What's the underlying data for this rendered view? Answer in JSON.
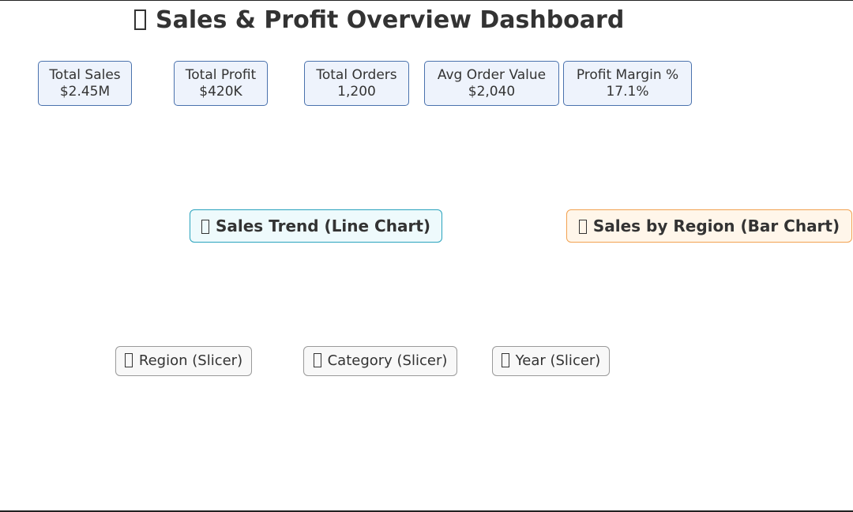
{
  "dashboard": {
    "title": "Sales & Profit Overview Dashboard",
    "title_icon": "missing-glyph-icon"
  },
  "kpis": [
    {
      "label": "Total Sales",
      "value": "$2.45M"
    },
    {
      "label": "Total Profit",
      "value": "$420K"
    },
    {
      "label": "Total Orders",
      "value": "1,200"
    },
    {
      "label": "Avg Order Value",
      "value": "$2,040"
    },
    {
      "label": "Profit Margin %",
      "value": "17.1%"
    }
  ],
  "charts": {
    "sales_trend": {
      "label": "Sales Trend (Line Chart)",
      "icon": "missing-glyph-icon"
    },
    "sales_by_region": {
      "label": "Sales by Region (Bar Chart)",
      "icon": "missing-glyph-icon"
    }
  },
  "slicers": [
    {
      "label": "Region (Slicer)",
      "icon": "missing-glyph-icon"
    },
    {
      "label": "Category (Slicer)",
      "icon": "missing-glyph-icon"
    },
    {
      "label": "Year (Slicer)",
      "icon": "missing-glyph-icon"
    }
  ],
  "colors": {
    "kpi_fill": "#eef3fc",
    "kpi_border": "#4a72ad",
    "line_chart_border": "#2aa3bd",
    "bar_chart_border": "#f2a251",
    "slicer_border": "#9a9a9a",
    "text": "#333333"
  }
}
